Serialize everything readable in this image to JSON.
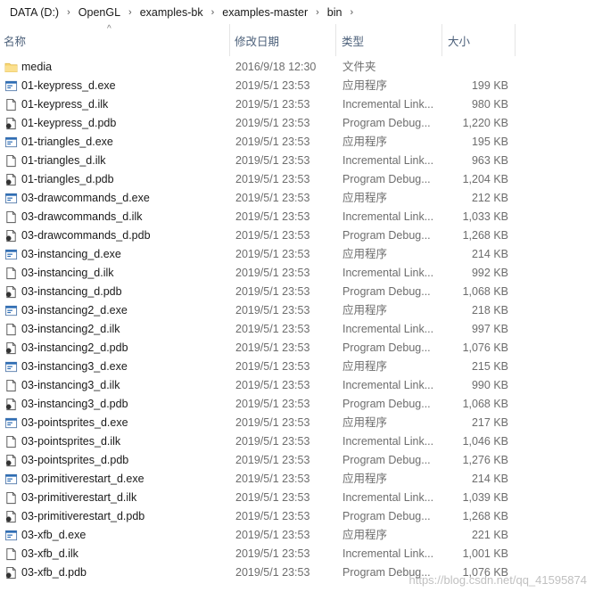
{
  "breadcrumb": {
    "items": [
      "DATA (D:)",
      "OpenGL",
      "examples-bk",
      "examples-master",
      "bin"
    ],
    "separator": "›"
  },
  "columns": {
    "name": "名称",
    "date": "修改日期",
    "type": "类型",
    "size": "大小",
    "sort_indicator": "^"
  },
  "files": [
    {
      "name": "media",
      "date": "2016/9/18 12:30",
      "type": "文件夹",
      "size": "",
      "icon": "folder-icon"
    },
    {
      "name": "01-keypress_d.exe",
      "date": "2019/5/1 23:53",
      "type": "应用程序",
      "size": "199 KB",
      "icon": "exe-icon"
    },
    {
      "name": "01-keypress_d.ilk",
      "date": "2019/5/1 23:53",
      "type": "Incremental Link...",
      "size": "980 KB",
      "icon": "file-icon"
    },
    {
      "name": "01-keypress_d.pdb",
      "date": "2019/5/1 23:53",
      "type": "Program Debug...",
      "size": "1,220 KB",
      "icon": "pdb-icon"
    },
    {
      "name": "01-triangles_d.exe",
      "date": "2019/5/1 23:53",
      "type": "应用程序",
      "size": "195 KB",
      "icon": "exe-icon"
    },
    {
      "name": "01-triangles_d.ilk",
      "date": "2019/5/1 23:53",
      "type": "Incremental Link...",
      "size": "963 KB",
      "icon": "file-icon"
    },
    {
      "name": "01-triangles_d.pdb",
      "date": "2019/5/1 23:53",
      "type": "Program Debug...",
      "size": "1,204 KB",
      "icon": "pdb-icon"
    },
    {
      "name": "03-drawcommands_d.exe",
      "date": "2019/5/1 23:53",
      "type": "应用程序",
      "size": "212 KB",
      "icon": "exe-icon"
    },
    {
      "name": "03-drawcommands_d.ilk",
      "date": "2019/5/1 23:53",
      "type": "Incremental Link...",
      "size": "1,033 KB",
      "icon": "file-icon"
    },
    {
      "name": "03-drawcommands_d.pdb",
      "date": "2019/5/1 23:53",
      "type": "Program Debug...",
      "size": "1,268 KB",
      "icon": "pdb-icon"
    },
    {
      "name": "03-instancing_d.exe",
      "date": "2019/5/1 23:53",
      "type": "应用程序",
      "size": "214 KB",
      "icon": "exe-icon"
    },
    {
      "name": "03-instancing_d.ilk",
      "date": "2019/5/1 23:53",
      "type": "Incremental Link...",
      "size": "992 KB",
      "icon": "file-icon"
    },
    {
      "name": "03-instancing_d.pdb",
      "date": "2019/5/1 23:53",
      "type": "Program Debug...",
      "size": "1,068 KB",
      "icon": "pdb-icon"
    },
    {
      "name": "03-instancing2_d.exe",
      "date": "2019/5/1 23:53",
      "type": "应用程序",
      "size": "218 KB",
      "icon": "exe-icon"
    },
    {
      "name": "03-instancing2_d.ilk",
      "date": "2019/5/1 23:53",
      "type": "Incremental Link...",
      "size": "997 KB",
      "icon": "file-icon"
    },
    {
      "name": "03-instancing2_d.pdb",
      "date": "2019/5/1 23:53",
      "type": "Program Debug...",
      "size": "1,076 KB",
      "icon": "pdb-icon"
    },
    {
      "name": "03-instancing3_d.exe",
      "date": "2019/5/1 23:53",
      "type": "应用程序",
      "size": "215 KB",
      "icon": "exe-icon"
    },
    {
      "name": "03-instancing3_d.ilk",
      "date": "2019/5/1 23:53",
      "type": "Incremental Link...",
      "size": "990 KB",
      "icon": "file-icon"
    },
    {
      "name": "03-instancing3_d.pdb",
      "date": "2019/5/1 23:53",
      "type": "Program Debug...",
      "size": "1,068 KB",
      "icon": "pdb-icon"
    },
    {
      "name": "03-pointsprites_d.exe",
      "date": "2019/5/1 23:53",
      "type": "应用程序",
      "size": "217 KB",
      "icon": "exe-icon"
    },
    {
      "name": "03-pointsprites_d.ilk",
      "date": "2019/5/1 23:53",
      "type": "Incremental Link...",
      "size": "1,046 KB",
      "icon": "file-icon"
    },
    {
      "name": "03-pointsprites_d.pdb",
      "date": "2019/5/1 23:53",
      "type": "Program Debug...",
      "size": "1,276 KB",
      "icon": "pdb-icon"
    },
    {
      "name": "03-primitiverestart_d.exe",
      "date": "2019/5/1 23:53",
      "type": "应用程序",
      "size": "214 KB",
      "icon": "exe-icon"
    },
    {
      "name": "03-primitiverestart_d.ilk",
      "date": "2019/5/1 23:53",
      "type": "Incremental Link...",
      "size": "1,039 KB",
      "icon": "file-icon"
    },
    {
      "name": "03-primitiverestart_d.pdb",
      "date": "2019/5/1 23:53",
      "type": "Program Debug...",
      "size": "1,268 KB",
      "icon": "pdb-icon"
    },
    {
      "name": "03-xfb_d.exe",
      "date": "2019/5/1 23:53",
      "type": "应用程序",
      "size": "221 KB",
      "icon": "exe-icon"
    },
    {
      "name": "03-xfb_d.ilk",
      "date": "2019/5/1 23:53",
      "type": "Incremental Link...",
      "size": "1,001 KB",
      "icon": "file-icon"
    },
    {
      "name": "03-xfb_d.pdb",
      "date": "2019/5/1 23:53",
      "type": "Program Debug...",
      "size": "1,076 KB",
      "icon": "pdb-icon"
    }
  ],
  "watermark": "https://blog.csdn.net/qq_41595874",
  "colors": {
    "header_text": "#4c607a",
    "folder": "#f8d775",
    "exe_accent": "#2b6cb5"
  }
}
